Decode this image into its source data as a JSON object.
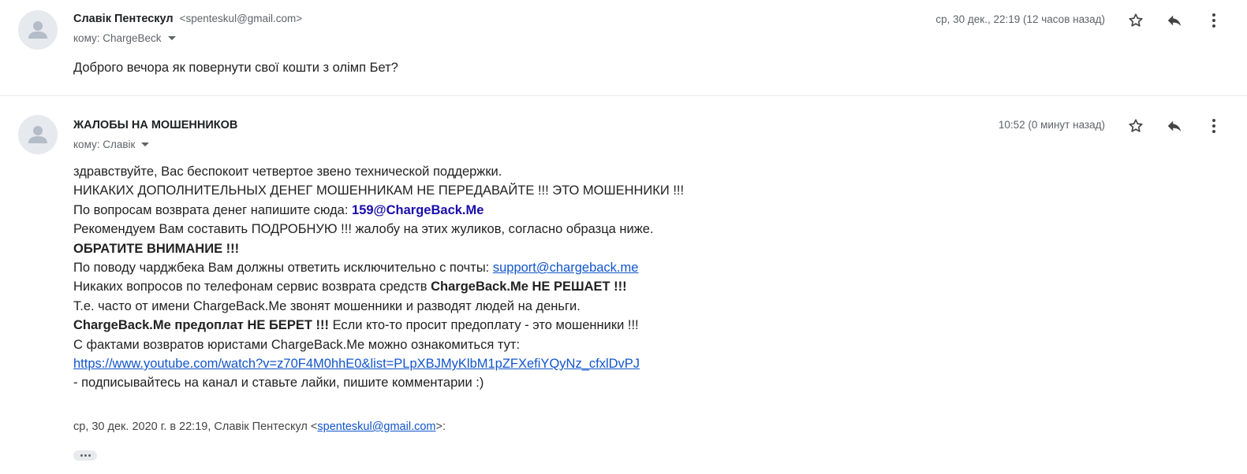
{
  "messages": [
    {
      "sender_name": "Славік Пентескул",
      "sender_email": "<spenteskul@gmail.com>",
      "to_label": "кому: ChargeBeck",
      "date": "ср, 30 дек., 22:19 (12 часов назад)",
      "body": "Доброго вечора як повернути свої кошти з олімп Бет?"
    },
    {
      "sender_name": "ЖАЛОБЫ НА МОШЕННИКОВ",
      "to_label": "кому: Славік",
      "date": "10:52 (0 минут назад)",
      "body": {
        "l1": "здравствуйте, Вас беспокоит четвертое звено технической поддержки.",
        "l2": "НИКАКИХ ДОПОЛНИТЕЛЬНЫХ ДЕНЕГ МОШЕННИКАМ НЕ ПЕРЕДАВАЙТЕ !!! ЭТО МОШЕННИКИ !!!",
        "l3_text": "По вопросам возврата денег напишите сюда: ",
        "l3_link": "159@ChargeBack.Me",
        "l4": "Рекомендуем Вам составить ПОДРОБНУЮ !!! жалобу на этих жуликов, согласно образца ниже.",
        "l5": "ОБРАТИТЕ ВНИМАНИЕ !!!",
        "l6_text": "По поводу чарджбека Вам должны ответить исключительно с почты: ",
        "l6_link": "support@chargeback.me",
        "l7_text": "Никаких вопросов по телефонам сервис возврата средств ",
        "l7_bold": "ChargeBack.Me НЕ РЕШАЕТ !!!",
        "l8": "Т.е. часто от имени ChargeBack.Me звонят мошенники и разводят людей на деньги.",
        "l9_bold": "ChargeBack.Me предоплат НЕ БЕРЕТ !!!",
        "l9_text": " Если кто-то просит предоплату - это мошенники !!!",
        "l10": "С фактами возвратов юристами ChargeBack.Me можно ознакомиться тут:",
        "l11_link": "https://www.youtube.com/watch?v=z70F4M0hhE0&list=PLpXBJMyKlbM1pZFXefiYQyNz_cfxlDvPJ",
        "l12": " - подписывайтесь на канал и ставьте лайки, пишите комментарии :)"
      },
      "quote_prefix": "ср, 30 дек. 2020 г. в 22:19, Славік Пентескул <",
      "quote_email": "spenteskul@gmail.com",
      "quote_suffix": ">:"
    }
  ],
  "icons": {
    "avatar": "default-avatar-icon",
    "star": "star-outline-icon",
    "reply": "reply-arrow-icon",
    "more": "vertical-dots-icon",
    "caret": "caret-down-icon",
    "show_trimmed": "ellipsis-icon"
  },
  "colors": {
    "link": "#1155cc",
    "link_bold": "#1a0dab",
    "avatar_bg": "#e6e9ee",
    "avatar_fg": "#b4bcc8",
    "meta_text": "#5f6368"
  }
}
